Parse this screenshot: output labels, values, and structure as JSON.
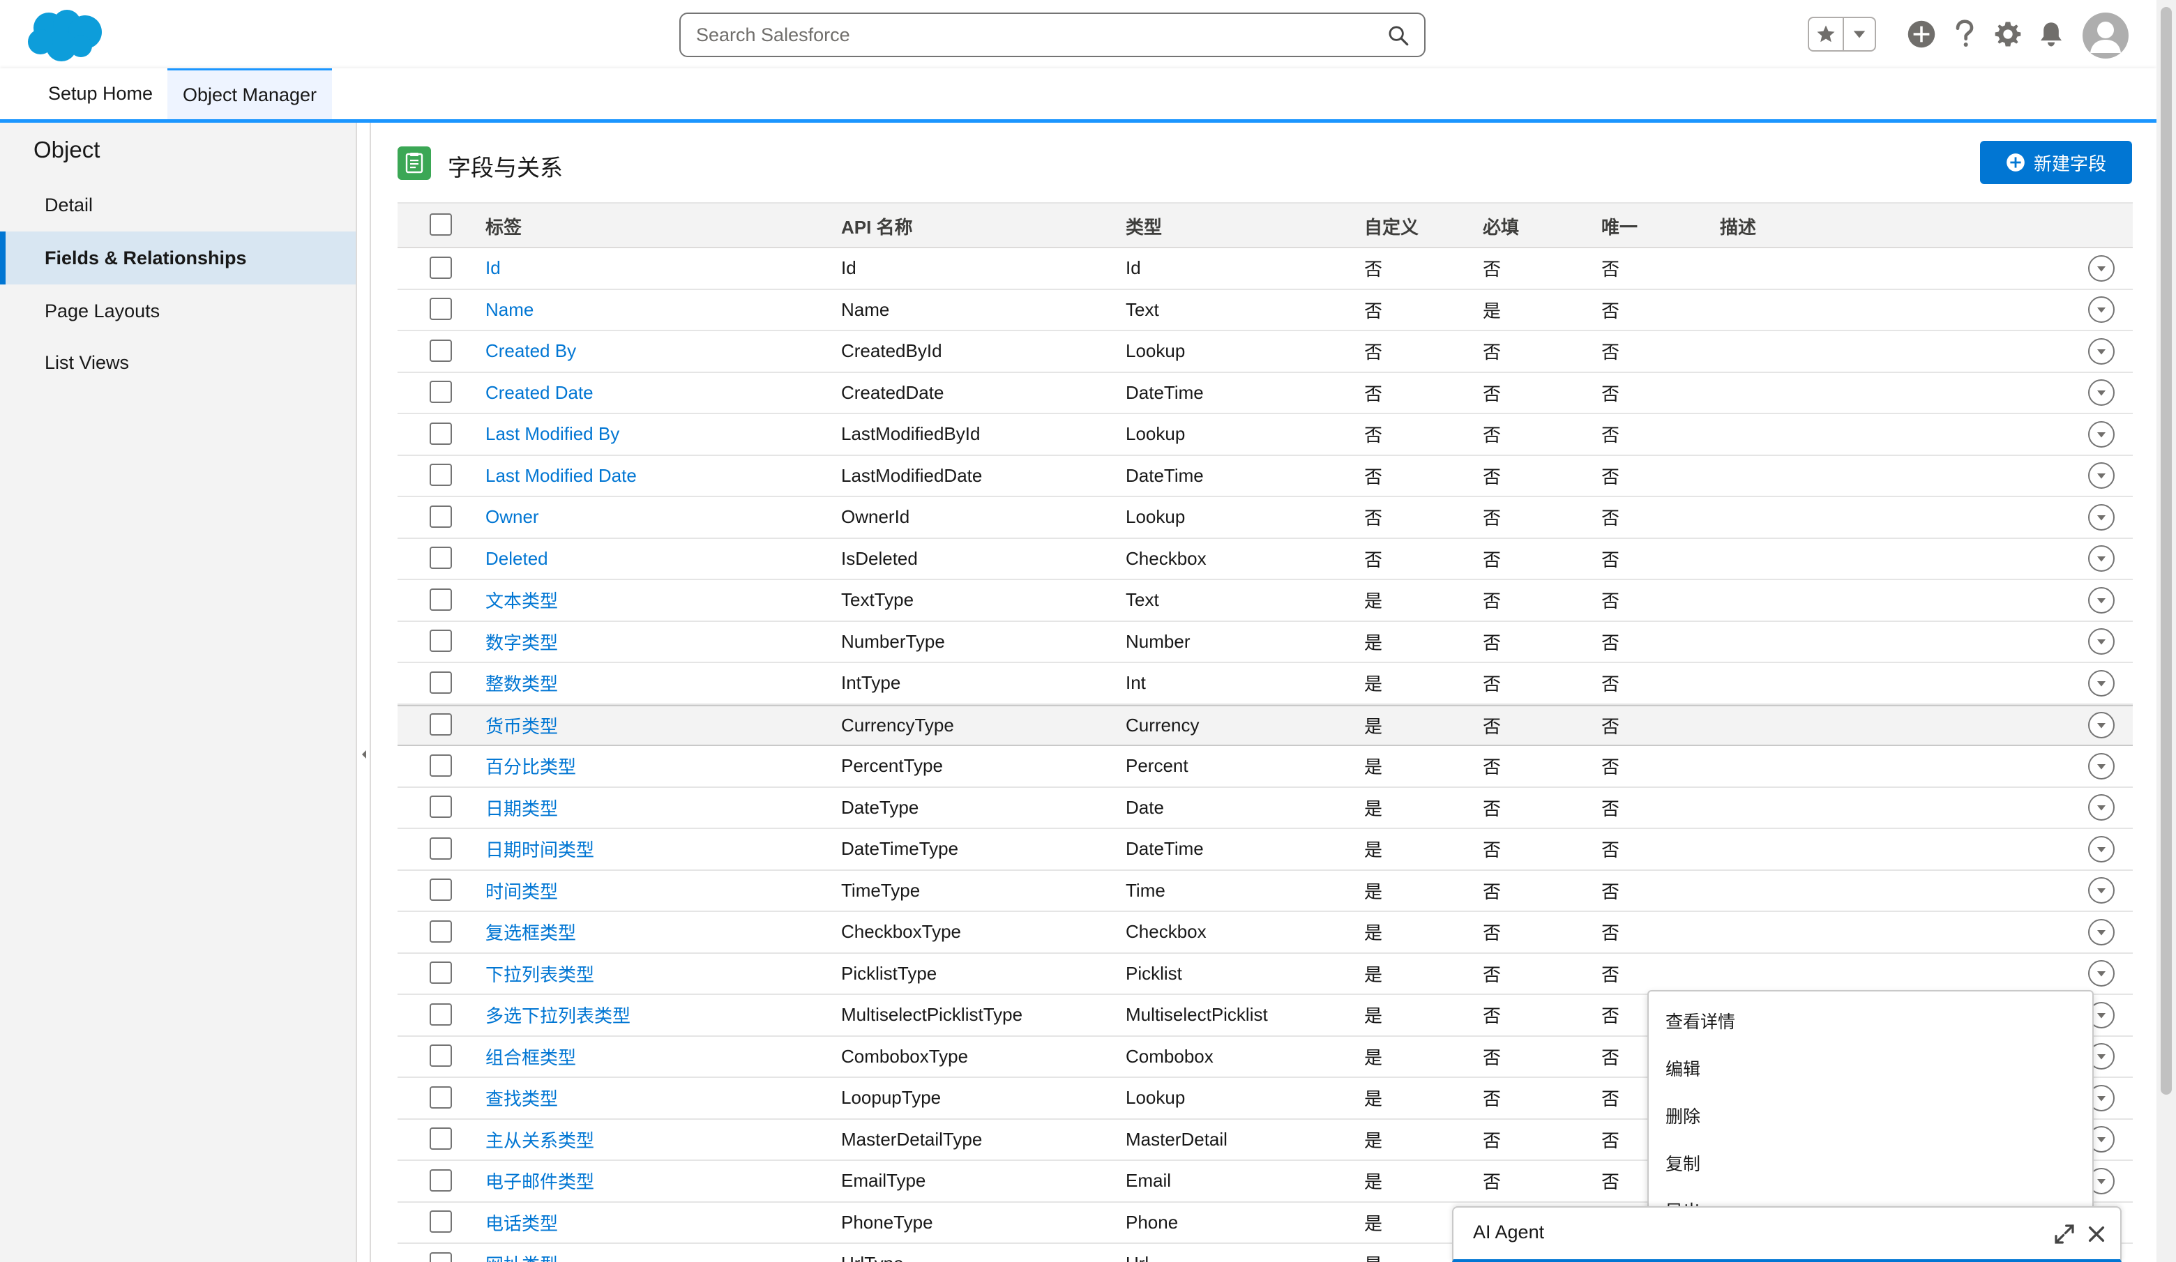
{
  "header": {
    "search_placeholder": "Search Salesforce",
    "icons": [
      "salesforce-cloud-logo",
      "search-icon",
      "star-icon",
      "chevron-down-icon",
      "add-icon",
      "help-icon",
      "gear-icon",
      "bell-icon",
      "avatar-icon"
    ]
  },
  "context_bar": {
    "tabs": [
      {
        "label": "Setup Home",
        "active": false
      },
      {
        "label": "Object Manager",
        "active": true
      }
    ]
  },
  "sidebar": {
    "title": "Object",
    "items": [
      {
        "label": "Detail",
        "selected": false
      },
      {
        "label": "Fields & Relationships",
        "selected": true
      },
      {
        "label": "Page Layouts",
        "selected": false
      },
      {
        "label": "List Views",
        "selected": false
      }
    ]
  },
  "main": {
    "title": "字段与关系",
    "new_field_button": "新建字段",
    "columns": [
      "标签",
      "API 名称",
      "类型",
      "自定义",
      "必填",
      "唯一",
      "描述"
    ],
    "rows": [
      {
        "label": "Id",
        "api": "Id",
        "type": "Id",
        "custom": "否",
        "required": "否",
        "unique": "否"
      },
      {
        "label": "Name",
        "api": "Name",
        "type": "Text",
        "custom": "否",
        "required": "是",
        "unique": "否"
      },
      {
        "label": "Created By",
        "api": "CreatedById",
        "type": "Lookup",
        "custom": "否",
        "required": "否",
        "unique": "否"
      },
      {
        "label": "Created Date",
        "api": "CreatedDate",
        "type": "DateTime",
        "custom": "否",
        "required": "否",
        "unique": "否"
      },
      {
        "label": "Last Modified By",
        "api": "LastModifiedById",
        "type": "Lookup",
        "custom": "否",
        "required": "否",
        "unique": "否"
      },
      {
        "label": "Last Modified Date",
        "api": "LastModifiedDate",
        "type": "DateTime",
        "custom": "否",
        "required": "否",
        "unique": "否"
      },
      {
        "label": "Owner",
        "api": "OwnerId",
        "type": "Lookup",
        "custom": "否",
        "required": "否",
        "unique": "否"
      },
      {
        "label": "Deleted",
        "api": "IsDeleted",
        "type": "Checkbox",
        "custom": "否",
        "required": "否",
        "unique": "否"
      },
      {
        "label": "文本类型",
        "api": "TextType",
        "type": "Text",
        "custom": "是",
        "required": "否",
        "unique": "否"
      },
      {
        "label": "数字类型",
        "api": "NumberType",
        "type": "Number",
        "custom": "是",
        "required": "否",
        "unique": "否"
      },
      {
        "label": "整数类型",
        "api": "IntType",
        "type": "Int",
        "custom": "是",
        "required": "否",
        "unique": "否"
      },
      {
        "label": "货币类型",
        "api": "CurrencyType",
        "type": "Currency",
        "custom": "是",
        "required": "否",
        "unique": "否",
        "hover": true
      },
      {
        "label": "百分比类型",
        "api": "PercentType",
        "type": "Percent",
        "custom": "是",
        "required": "否",
        "unique": "否"
      },
      {
        "label": "日期类型",
        "api": "DateType",
        "type": "Date",
        "custom": "是",
        "required": "否",
        "unique": "否"
      },
      {
        "label": "日期时间类型",
        "api": "DateTimeType",
        "type": "DateTime",
        "custom": "是",
        "required": "否",
        "unique": "否"
      },
      {
        "label": "时间类型",
        "api": "TimeType",
        "type": "Time",
        "custom": "是",
        "required": "否",
        "unique": "否"
      },
      {
        "label": "复选框类型",
        "api": "CheckboxType",
        "type": "Checkbox",
        "custom": "是",
        "required": "否",
        "unique": "否"
      },
      {
        "label": "下拉列表类型",
        "api": "PicklistType",
        "type": "Picklist",
        "custom": "是",
        "required": "否",
        "unique": "否"
      },
      {
        "label": "多选下拉列表类型",
        "api": "MultiselectPicklistType",
        "type": "MultiselectPicklist",
        "custom": "是",
        "required": "否",
        "unique": "否"
      },
      {
        "label": "组合框类型",
        "api": "ComboboxType",
        "type": "Combobox",
        "custom": "是",
        "required": "否",
        "unique": "否"
      },
      {
        "label": "查找类型",
        "api": "LoopupType",
        "type": "Lookup",
        "custom": "是",
        "required": "否",
        "unique": "否"
      },
      {
        "label": "主从关系类型",
        "api": "MasterDetailType",
        "type": "MasterDetail",
        "custom": "是",
        "required": "否",
        "unique": "否"
      },
      {
        "label": "电子邮件类型",
        "api": "EmailType",
        "type": "Email",
        "custom": "是",
        "required": "否",
        "unique": "否"
      },
      {
        "label": "电话类型",
        "api": "PhoneType",
        "type": "Phone",
        "custom": "是",
        "required": "",
        "unique": ""
      },
      {
        "label": "网址类型",
        "api": "UrlType",
        "type": "Url",
        "custom": "是",
        "required": "",
        "unique": ""
      }
    ]
  },
  "dropdown": {
    "items": [
      "查看详情",
      "编辑",
      "删除",
      "复制",
      "导出"
    ]
  },
  "ai_agent": {
    "title": "AI Agent"
  },
  "colors": {
    "brand": "#0176d3",
    "accent_bar": "#1b96ff",
    "title_icon": "#3ba755"
  }
}
